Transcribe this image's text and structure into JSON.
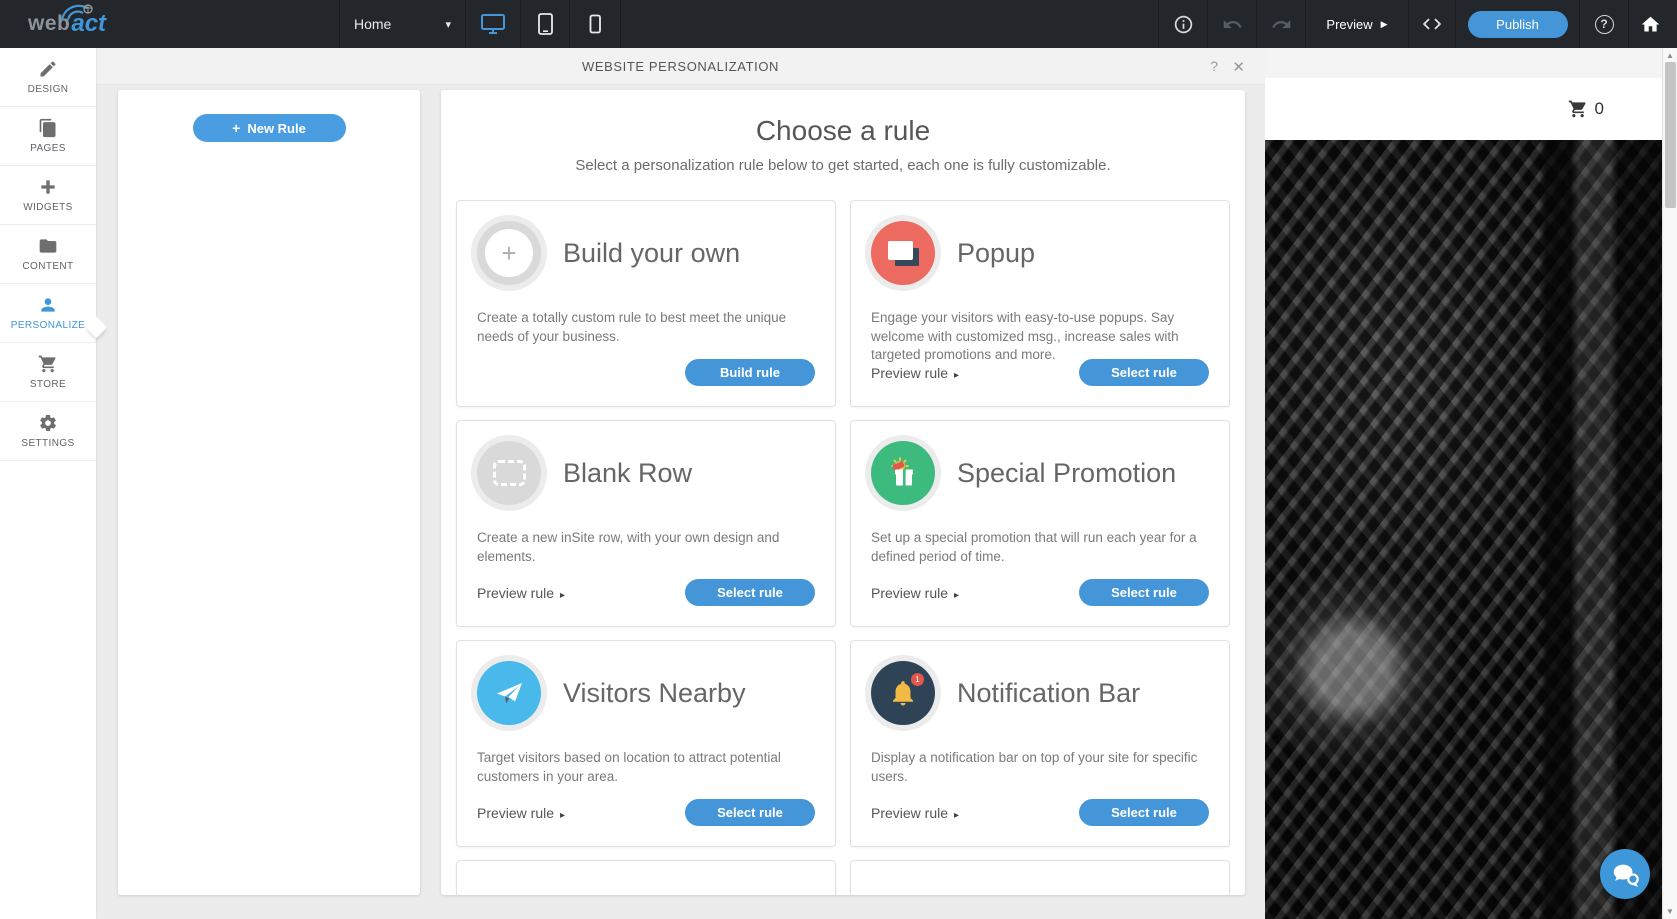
{
  "topbar": {
    "logo_web": "web",
    "logo_act": "act",
    "page_selector": {
      "value": "Home"
    },
    "preview_label": "Preview",
    "publish_label": "Publish"
  },
  "sidebar": {
    "items": [
      {
        "label": "DESIGN"
      },
      {
        "label": "PAGES"
      },
      {
        "label": "WIDGETS"
      },
      {
        "label": "CONTENT"
      },
      {
        "label": "PERSONALIZE"
      },
      {
        "label": "STORE"
      },
      {
        "label": "SETTINGS"
      }
    ]
  },
  "modal": {
    "header_title": "WEBSITE PERSONALIZATION",
    "new_rule_label": "New Rule",
    "choose_title": "Choose a rule",
    "choose_subtitle": "Select a personalization rule below to get started, each one is fully customizable.",
    "cards": [
      {
        "title": "Build your own",
        "description": "Create a totally custom rule to best meet the unique needs of your business.",
        "action": "Build rule",
        "preview": ""
      },
      {
        "title": "Popup",
        "description": "Engage your visitors with easy-to-use popups. Say welcome with customized msg., increase sales with targeted promotions and more.",
        "action": "Select rule",
        "preview": "Preview rule"
      },
      {
        "title": "Blank Row",
        "description": "Create a new inSite row, with your own design and elements.",
        "action": "Select rule",
        "preview": "Preview rule"
      },
      {
        "title": "Special Promotion",
        "description": "Set up a special promotion that will run each year for a defined period of time.",
        "action": "Select rule",
        "preview": "Preview rule"
      },
      {
        "title": "Visitors Nearby",
        "description": "Target visitors based on location to attract potential customers in your area.",
        "action": "Select rule",
        "preview": "Preview rule"
      },
      {
        "title": "Notification Bar",
        "description": "Display a notification bar on top of your site for specific users.",
        "action": "Select rule",
        "preview": "Preview rule",
        "badge": "1"
      }
    ]
  },
  "site_preview": {
    "cart_count": "0"
  },
  "icons": {
    "chevron_down": "▾",
    "preview_play": "▶",
    "help": "?",
    "close": "✕",
    "preview_arrow": "▸",
    "plus": "+",
    "scroll_up": "▲",
    "scroll_down": "▼"
  },
  "colors": {
    "accent_blue": "#4596d8",
    "popup_icon": "#ec6a5f",
    "blank_icon": "#d9d9d9",
    "promo_icon": "#3dbb7e",
    "visitors_icon": "#49b8eb",
    "notification_icon": "#2e4356",
    "bell": "#f0ba44",
    "badge_red": "#e2574c",
    "topbar_bg": "#23272c"
  }
}
